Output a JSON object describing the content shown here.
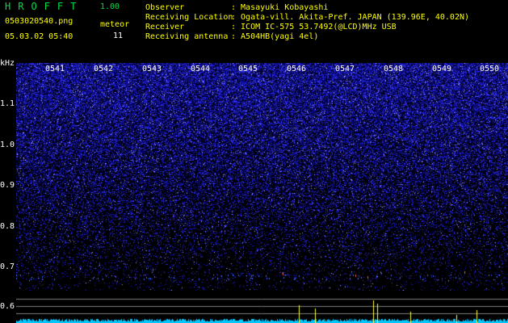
{
  "header": {
    "app_title": "HROFFT",
    "app_version": "1.00",
    "file_name": "0503020540.png",
    "datetime": "05.03.02 05:40",
    "meteor_label": "meteor",
    "meteor_count": "11"
  },
  "station": {
    "observer_label": "Observer",
    "observer_value": ": Masayuki Kobayashi",
    "location_label": "Receiving Location",
    "location_value": ": Ogata-vill. Akita-Pref. JAPAN (139.96E, 40.02N)",
    "receiver_label": "Receiver",
    "receiver_value": ": ICOM IC-575 53.7492(@LCD)MHz USB",
    "antenna_label": "Receiving antenna",
    "antenna_value": ": A504HB(yagi 4el)"
  },
  "axis": {
    "y_unit": "kHz",
    "y_ticks": [
      "1.1",
      "1.0",
      "0.9",
      "0.8",
      "0.7",
      "0.6"
    ],
    "x_ticks": [
      "0541",
      "0542",
      "0543",
      "0544",
      "0545",
      "0546",
      "0547",
      "0548",
      "0549",
      "0550"
    ]
  },
  "colors": {
    "background": "#000000",
    "noise": "#2a2aff",
    "header_green": "#00e040",
    "header_yellow": "#ffff00",
    "baseline": "#00c8ff",
    "meteor_spike": "#ffff40"
  }
}
